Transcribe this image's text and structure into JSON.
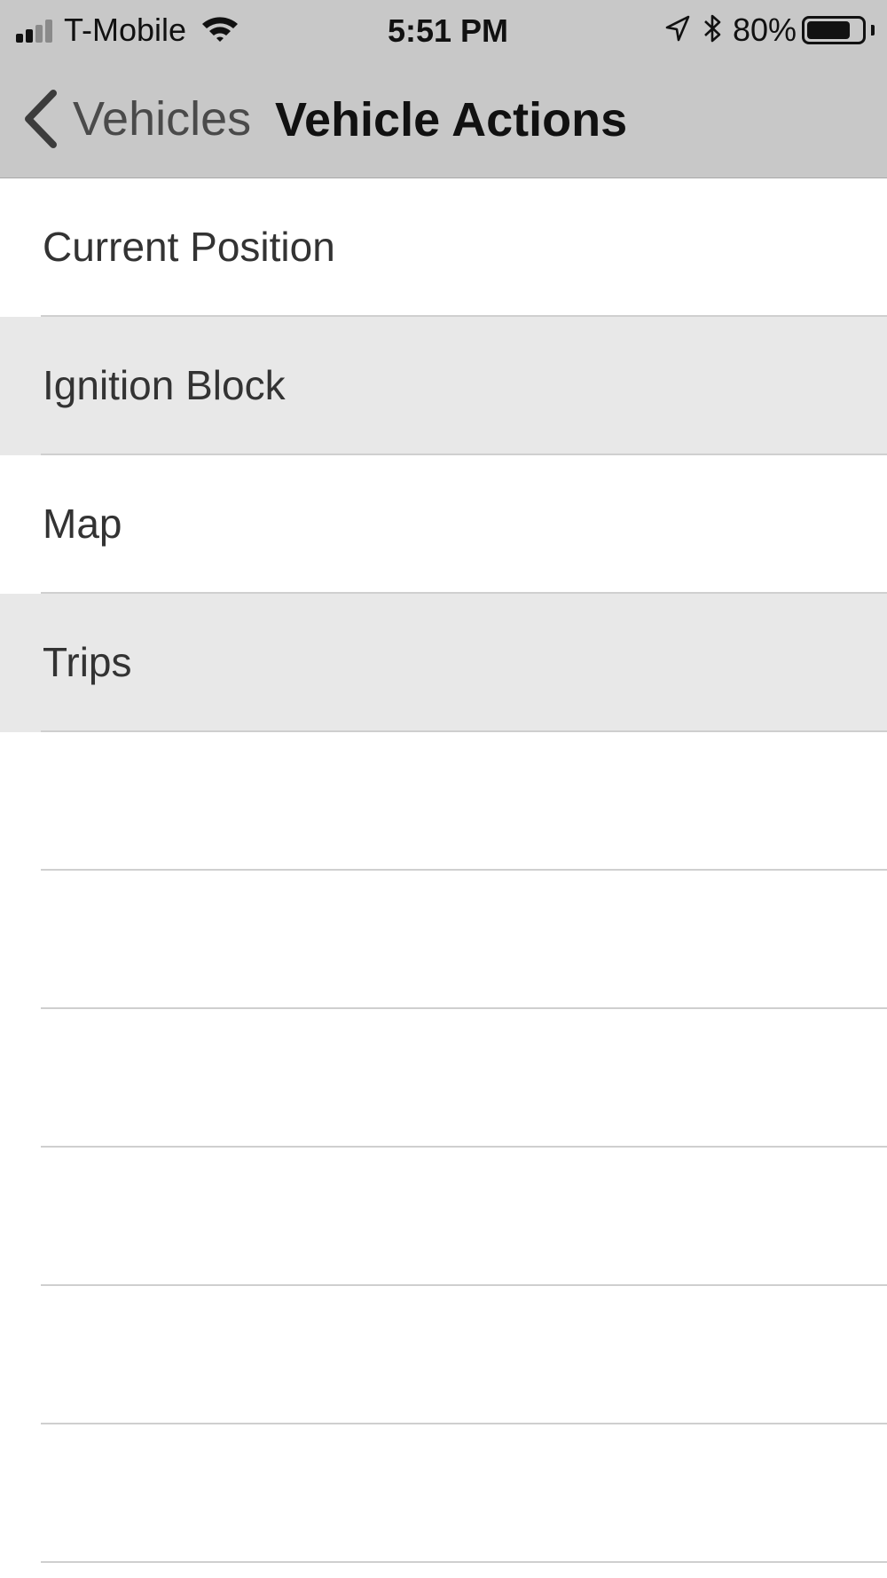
{
  "status_bar": {
    "carrier": "T-Mobile",
    "time": "5:51 PM",
    "battery_percent": "80%",
    "battery_level": 0.8,
    "signal_bars_filled": 2,
    "signal_bars_total": 4,
    "icons": [
      "signal-icon",
      "wifi-icon",
      "location-arrow-icon",
      "bluetooth-icon",
      "battery-icon"
    ]
  },
  "nav_bar": {
    "back_label": "Vehicles",
    "title": "Vehicle Actions",
    "back_icon": "chevron-left-icon"
  },
  "menu": {
    "items": [
      {
        "label": "Current Position",
        "highlighted": false
      },
      {
        "label": "Ignition Block",
        "highlighted": true
      },
      {
        "label": "Map",
        "highlighted": false
      },
      {
        "label": "Trips",
        "highlighted": true
      }
    ]
  },
  "colors": {
    "bar_background": "#c8c8c8",
    "row_highlight": "#e8e8e8",
    "separator": "#cfcfcf"
  }
}
